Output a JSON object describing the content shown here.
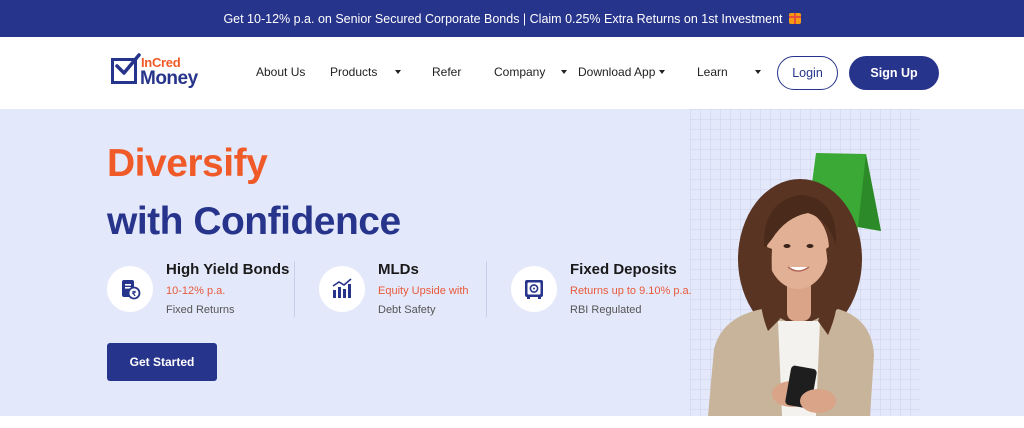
{
  "announcement": {
    "text": "Get 10-12% p.a. on Senior Secured Corporate Bonds | Claim 0.25% Extra Returns on 1st Investment",
    "icon": "gift-icon"
  },
  "logo": {
    "line1": "InCred",
    "line2": "Money"
  },
  "nav": {
    "items": [
      {
        "label": "About Us",
        "has_dropdown": false
      },
      {
        "label": "Products",
        "has_dropdown": true
      },
      {
        "label": "Refer",
        "has_dropdown": false
      },
      {
        "label": "Company",
        "has_dropdown": true
      },
      {
        "label": "Download App",
        "has_dropdown": true
      },
      {
        "label": "Learn",
        "has_dropdown": true
      }
    ],
    "login": "Login",
    "signup": "Sign Up"
  },
  "hero": {
    "title_line1": "Diversify",
    "title_line2": "with Confidence",
    "features": [
      {
        "title": "High Yield Bonds",
        "sub1": "10-12%  p.a.",
        "sub2": "Fixed Returns",
        "icon": "bond-certificate-icon"
      },
      {
        "title": "MLDs",
        "sub1": "Equity Upside with",
        "sub2": "Debt Safety",
        "icon": "bar-chart-icon"
      },
      {
        "title": "Fixed Deposits",
        "sub1": "Returns up to 9.10% p.a.",
        "sub2": "RBI Regulated",
        "icon": "safe-vault-icon"
      }
    ],
    "cta": "Get Started"
  },
  "colors": {
    "brand_navy": "#27348b",
    "brand_orange": "#f05a28",
    "hero_bg": "#e4e8fb",
    "accent_green": "#3aa935"
  }
}
